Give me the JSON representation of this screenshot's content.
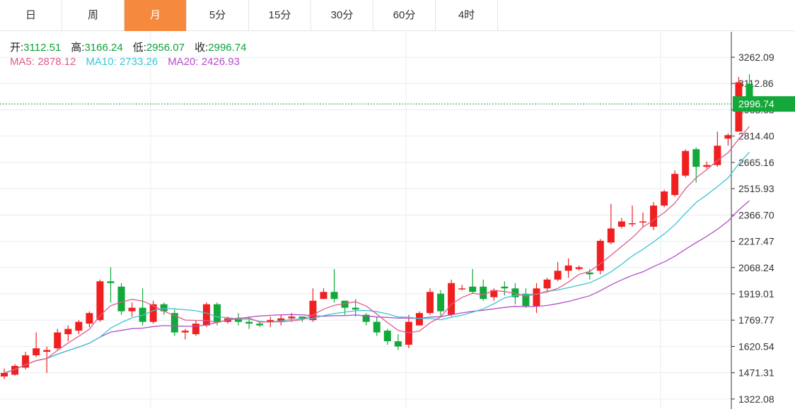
{
  "tabs": [
    {
      "label": "日",
      "active": false
    },
    {
      "label": "周",
      "active": false
    },
    {
      "label": "月",
      "active": true
    },
    {
      "label": "5分",
      "active": false
    },
    {
      "label": "15分",
      "active": false
    },
    {
      "label": "30分",
      "active": false
    },
    {
      "label": "60分",
      "active": false
    },
    {
      "label": "4时",
      "active": false
    }
  ],
  "ohlc_info": {
    "open_label": "开:",
    "open_value": "3112.51",
    "high_label": "高:",
    "high_value": "3166.24",
    "low_label": "低:",
    "low_value": "2956.07",
    "close_label": "收:",
    "close_value": "2996.74"
  },
  "ma_info": {
    "ma5_label": "MA5:",
    "ma5_value": "2878.12",
    "ma10_label": "MA10:",
    "ma10_value": "2733.26",
    "ma20_label": "MA20:",
    "ma20_value": "2426.93"
  },
  "current_price_tag": "2996.74",
  "colors": {
    "up": "#f02020",
    "down": "#13a83a",
    "ma5": "#e05c8c",
    "ma10": "#3cc5d0",
    "ma20": "#b44ec9",
    "grid": "#e6edf3",
    "price_line": "#1aa23a",
    "accent": "#f5893d"
  },
  "chart_data": {
    "type": "candlestick",
    "y_ticks": [
      "3262.09",
      "3112.86",
      "2963.63",
      "2814.40",
      "2665.16",
      "2515.93",
      "2366.70",
      "2217.47",
      "2068.24",
      "1919.01",
      "1769.77",
      "1620.54",
      "1471.31",
      "1322.08"
    ],
    "ylim": [
      1322.08,
      3350
    ],
    "grid": true,
    "candles": [
      [
        1450,
        1470,
        1435,
        1495
      ],
      [
        1460,
        1510,
        1455,
        1520
      ],
      [
        1500,
        1570,
        1490,
        1590
      ],
      [
        1570,
        1610,
        1560,
        1700
      ],
      [
        1590,
        1600,
        1470,
        1620
      ],
      [
        1610,
        1700,
        1600,
        1720
      ],
      [
        1690,
        1720,
        1650,
        1740
      ],
      [
        1710,
        1760,
        1690,
        1770
      ],
      [
        1750,
        1810,
        1730,
        1820
      ],
      [
        1770,
        1990,
        1760,
        2000
      ],
      [
        1990,
        1980,
        1870,
        2070
      ],
      [
        1960,
        1820,
        1800,
        1980
      ],
      [
        1820,
        1840,
        1790,
        1870
      ],
      [
        1840,
        1760,
        1740,
        1950
      ],
      [
        1760,
        1860,
        1750,
        1880
      ],
      [
        1860,
        1820,
        1800,
        1870
      ],
      [
        1810,
        1700,
        1680,
        1830
      ],
      [
        1700,
        1710,
        1660,
        1720
      ],
      [
        1690,
        1750,
        1680,
        1770
      ],
      [
        1740,
        1860,
        1730,
        1870
      ],
      [
        1860,
        1760,
        1740,
        1870
      ],
      [
        1760,
        1780,
        1750,
        1790
      ],
      [
        1780,
        1760,
        1740,
        1810
      ],
      [
        1760,
        1750,
        1720,
        1790
      ],
      [
        1750,
        1740,
        1730,
        1760
      ],
      [
        1760,
        1770,
        1730,
        1790
      ],
      [
        1760,
        1780,
        1740,
        1800
      ],
      [
        1780,
        1790,
        1760,
        1810
      ],
      [
        1790,
        1780,
        1760,
        1790
      ],
      [
        1770,
        1880,
        1760,
        1950
      ],
      [
        1890,
        1930,
        1890,
        1950
      ],
      [
        1930,
        1890,
        1870,
        2060
      ],
      [
        1880,
        1840,
        1800,
        1870
      ],
      [
        1840,
        1830,
        1790,
        1890
      ],
      [
        1800,
        1760,
        1740,
        1810
      ],
      [
        1760,
        1700,
        1680,
        1790
      ],
      [
        1710,
        1650,
        1630,
        1720
      ],
      [
        1650,
        1620,
        1600,
        1690
      ],
      [
        1630,
        1760,
        1610,
        1800
      ],
      [
        1740,
        1810,
        1740,
        1820
      ],
      [
        1810,
        1930,
        1800,
        1950
      ],
      [
        1920,
        1820,
        1790,
        1940
      ],
      [
        1800,
        1980,
        1790,
        2000
      ],
      [
        1950,
        1950,
        1940,
        1970
      ],
      [
        1960,
        1930,
        1920,
        2060
      ],
      [
        1960,
        1890,
        1880,
        2000
      ],
      [
        1900,
        1940,
        1880,
        1950
      ],
      [
        1960,
        1950,
        1910,
        1990
      ],
      [
        1950,
        1900,
        1860,
        1980
      ],
      [
        1920,
        1850,
        1840,
        1950
      ],
      [
        1850,
        1950,
        1810,
        1980
      ],
      [
        1950,
        2000,
        1930,
        2010
      ],
      [
        2000,
        2050,
        1990,
        2100
      ],
      [
        2050,
        2080,
        2010,
        2120
      ],
      [
        2060,
        2070,
        2050,
        2080
      ],
      [
        2040,
        2030,
        2000,
        2060
      ],
      [
        2050,
        2220,
        2030,
        2230
      ],
      [
        2210,
        2290,
        2200,
        2430
      ],
      [
        2300,
        2330,
        2290,
        2350
      ],
      [
        2320,
        2320,
        2300,
        2420
      ],
      [
        2330,
        2330,
        2300,
        2380
      ],
      [
        2300,
        2420,
        2280,
        2440
      ],
      [
        2420,
        2500,
        2410,
        2510
      ],
      [
        2480,
        2600,
        2470,
        2620
      ],
      [
        2590,
        2730,
        2580,
        2740
      ],
      [
        2740,
        2640,
        2550,
        2750
      ],
      [
        2640,
        2650,
        2630,
        2670
      ],
      [
        2650,
        2760,
        2640,
        2840
      ],
      [
        2800,
        2820,
        2760,
        2830
      ],
      [
        2840,
        3120,
        2840,
        3150
      ],
      [
        3112.51,
        2996.74,
        2956.07,
        3166.24
      ]
    ]
  }
}
